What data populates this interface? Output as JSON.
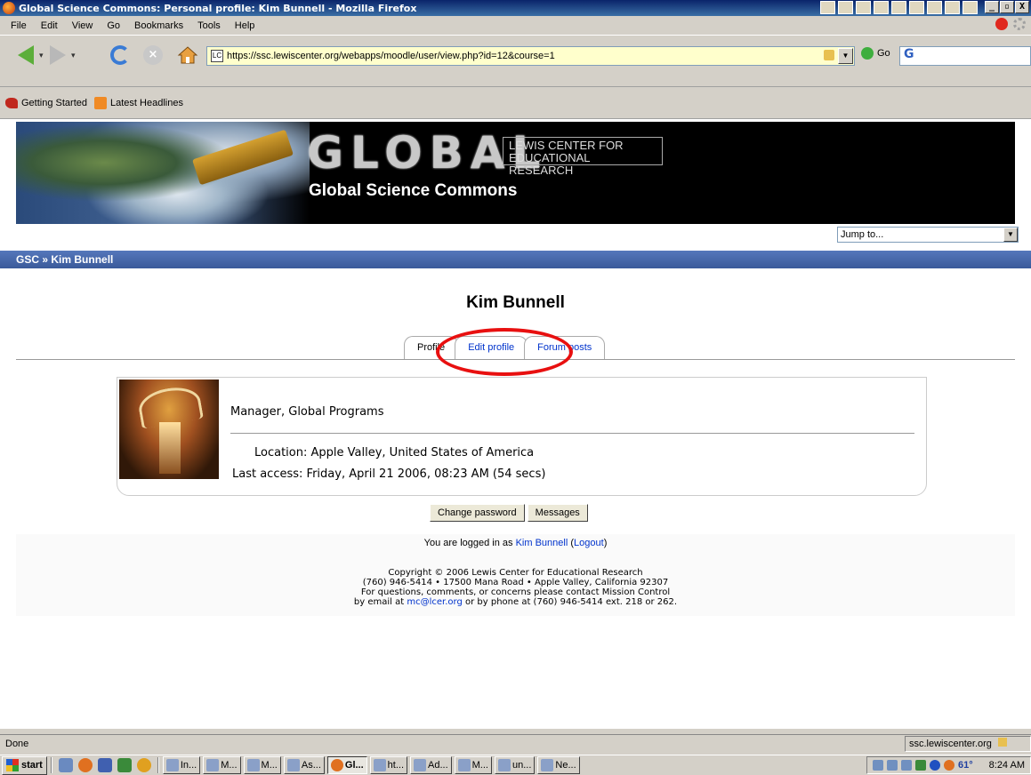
{
  "window": {
    "title": "Global Science Commons: Personal profile: Kim Bunnell - Mozilla Firefox",
    "controls": [
      "_",
      "▫",
      "X"
    ]
  },
  "menu": [
    "File",
    "Edit",
    "View",
    "Go",
    "Bookmarks",
    "Tools",
    "Help"
  ],
  "toolbar": {
    "url": "https://ssc.lewiscenter.org/webapps/moodle/user/view.php?id=12&course=1",
    "go_label": "Go",
    "search_glyph": "G"
  },
  "bookmarks": [
    "Getting Started",
    "Latest Headlines"
  ],
  "banner": {
    "logo_main": "GLOBAL",
    "logo_org_line1": "LEWIS CENTER FOR",
    "logo_org_line2": "EDUCATIONAL RESEARCH",
    "logo_sub": "Global Science Commons"
  },
  "jumpto": {
    "selected": "Jump to..."
  },
  "breadcrumb": {
    "root": "GSC",
    "sep": "»",
    "current": "Kim Bunnell"
  },
  "profile": {
    "fullname": "Kim Bunnell",
    "tabs": [
      "Profile",
      "Edit profile",
      "Forum posts"
    ],
    "role": "Manager, Global Programs",
    "location_label": "Location:",
    "location_value": "Apple Valley, United States of America",
    "last_access_label": "Last access:",
    "last_access_value": "Friday, April 21 2006, 08:23 AM  (54 secs)"
  },
  "buttons": {
    "change_password": "Change password",
    "messages": "Messages"
  },
  "footer": {
    "login_prefix": "You are logged in as",
    "login_user": "Kim Bunnell",
    "logout": "Logout",
    "copyright": "Copyright © 2006 Lewis Center for Educational Research",
    "address": "(760) 946-5414 • 17500 Mana Road • Apple Valley, California 92307",
    "contact_line": "For questions, comments, or concerns please contact Mission Control",
    "email_prefix": "by email at",
    "email": "mc@lcer.org",
    "phone_suffix": "or by phone at (760) 946-5414 ext. 218 or 262."
  },
  "status": {
    "left": "Done",
    "right": "ssc.lewiscenter.org"
  },
  "taskbar": {
    "start": "start",
    "tasks": [
      "In...",
      "M...",
      "M...",
      "As...",
      "Gl...",
      "ht...",
      "Ad...",
      "M...",
      "un...",
      "Ne..."
    ],
    "active_index": 4,
    "temperature": "61°",
    "clock": "8:24 AM"
  },
  "colors": {
    "annotation_circle": "#e81010",
    "nav_strip": "#3a5a9a",
    "link": "#0033cc"
  }
}
